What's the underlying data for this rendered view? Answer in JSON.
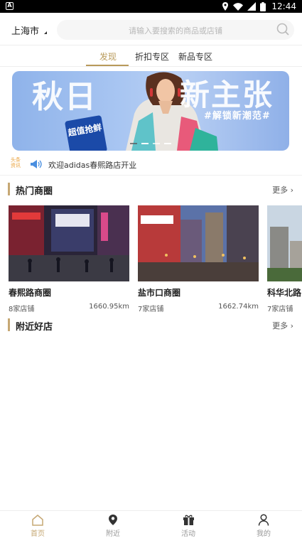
{
  "statusbar": {
    "time": "12:44"
  },
  "topbar": {
    "city": "上海市",
    "search_placeholder": "请输入要搜索的商品或店铺"
  },
  "tabs": [
    {
      "label": "发现",
      "active": true
    },
    {
      "label": "折扣专区",
      "active": false
    },
    {
      "label": "新品专区",
      "active": false
    }
  ],
  "banner": {
    "title_left": "秋日",
    "title_right": "新主张",
    "subtitle": "#解锁新潮范#",
    "badge": "超值抢鲜",
    "active_slide": 1,
    "slide_count": 4
  },
  "notice": {
    "badge": "头条资讯",
    "text": "欢迎adidas春熙路店开业"
  },
  "hot_section": {
    "title": "热门商圈",
    "more": "更多"
  },
  "districts": [
    {
      "name": "春熙路商圈",
      "count": "8家店铺",
      "distance": "1660.95km"
    },
    {
      "name": "盐市口商圈",
      "count": "7家店铺",
      "distance": "1662.74km"
    },
    {
      "name": "科华北路",
      "count": "7家店铺",
      "distance": ""
    }
  ],
  "nearby_section": {
    "title": "附近好店",
    "more": "更多"
  },
  "bottom_nav": [
    {
      "label": "首页",
      "icon": "home-icon",
      "active": true
    },
    {
      "label": "附近",
      "icon": "location-pin-icon",
      "active": false
    },
    {
      "label": "活动",
      "icon": "gift-icon",
      "active": false
    },
    {
      "label": "我的",
      "icon": "person-icon",
      "active": false
    }
  ],
  "colors": {
    "accent": "#c6a874",
    "tab_active": "#b89a5a",
    "banner_blue": "#8fb3ea"
  }
}
